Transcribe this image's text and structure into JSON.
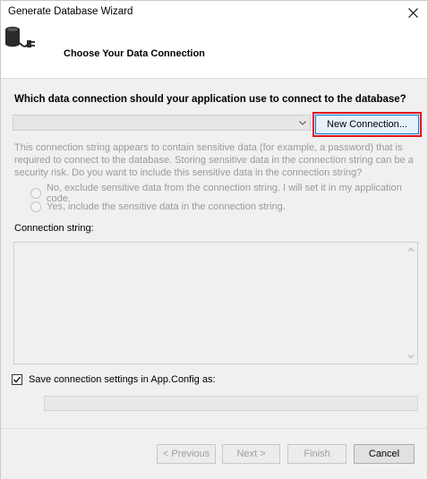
{
  "window": {
    "title": "Generate Database Wizard"
  },
  "header": {
    "title": "Choose Your Data Connection",
    "icon": "database-plug-icon"
  },
  "connection": {
    "question": "Which data connection should your application use to connect to the database?",
    "selected_value": "",
    "new_connection_label": "New Connection...",
    "highlight_color": "#e3131a"
  },
  "sensitive": {
    "description": "This connection string appears to contain sensitive data (for example, a password) that is required to connect to the database. Storing sensitive data in the connection string can be a security risk. Do you want to include this sensitive data in the connection string?",
    "option_no": "No, exclude sensitive data from the connection string. I will set it in my application code.",
    "option_yes": "Yes, include the sensitive data in the connection string."
  },
  "connection_string": {
    "label": "Connection string:",
    "value": ""
  },
  "save_settings": {
    "label": "Save connection settings in App.Config as:",
    "checked": true,
    "value": ""
  },
  "footer": {
    "previous_label": "< Previous",
    "next_label": "Next >",
    "finish_label": "Finish",
    "cancel_label": "Cancel"
  }
}
